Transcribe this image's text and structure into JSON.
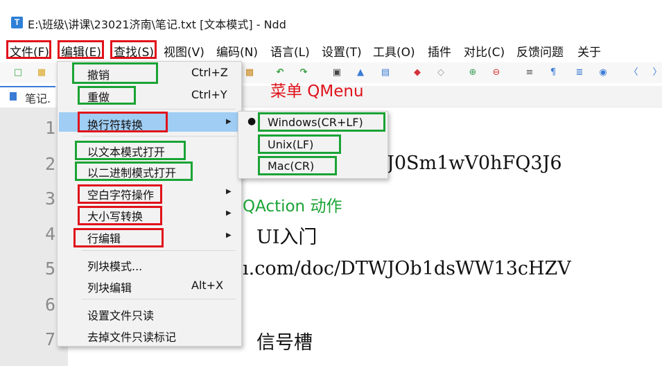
{
  "window": {
    "title": "E:\\班级\\讲课\\23021济南\\笔记.txt [文本模式] - Ndd",
    "app_icon_letter": "T"
  },
  "menubar": [
    "文件(F)",
    "编辑(E)",
    "查找(S)",
    "视图(V)",
    "编码(N)",
    "语言(L)",
    "设置(T)",
    "工具(O)",
    "插件",
    "对比(C)",
    "反馈问题",
    "关于"
  ],
  "tab": {
    "label": "笔记."
  },
  "editor": {
    "line_numbers": [
      "1",
      "2",
      "3",
      "4",
      "5",
      "6",
      "7"
    ],
    "visible_text": {
      "line2": "J0Sm1wV0hFQ3J6",
      "line4": "UI入门",
      "line5": "ı.com/doc/DTWJOb1dsWW13cHZV",
      "line7": "信号槽"
    }
  },
  "edit_menu": {
    "items": [
      {
        "label": "撤销",
        "shortcut": "Ctrl+Z"
      },
      {
        "label": "重做",
        "shortcut": "Ctrl+Y"
      },
      {
        "label": "换行符转换",
        "submenu": true,
        "highlighted": true
      },
      {
        "label": "以文本模式打开"
      },
      {
        "label": "以二进制模式打开"
      },
      {
        "label": "空白字符操作",
        "submenu": true
      },
      {
        "label": "大小写转换",
        "submenu": true
      },
      {
        "label": "行编辑",
        "submenu": true
      },
      {
        "label": "列块模式..."
      },
      {
        "label": "列块编辑",
        "shortcut": "Alt+X"
      },
      {
        "label": "设置文件只读"
      },
      {
        "label": "去掉文件只读标记"
      }
    ]
  },
  "eol_submenu": {
    "items": [
      {
        "label": "Windows(CR+LF)",
        "checked": true
      },
      {
        "label": "Unix(LF)"
      },
      {
        "label": "Mac(CR)"
      }
    ]
  },
  "annotations": {
    "menu_label": "菜单 QMenu",
    "action_label": "QAction 动作"
  },
  "colors": {
    "annotation_red": "#e0121a",
    "annotation_green": "#1aa335",
    "menu_highlight": "#9fcdf3",
    "tab_accent": "#3a7bd5"
  },
  "icons": [
    "new-file-icon",
    "open-folder-icon",
    "paste-icon",
    "undo-icon",
    "redo-icon",
    "find-icon",
    "replace-icon",
    "goto-icon",
    "mark-icon",
    "clear-mark-icon",
    "zoom-in-icon",
    "zoom-out-icon",
    "wrap-icon",
    "show-symbols-icon",
    "indent-guide-icon",
    "record-icon",
    "prev-icon",
    "next-icon"
  ]
}
